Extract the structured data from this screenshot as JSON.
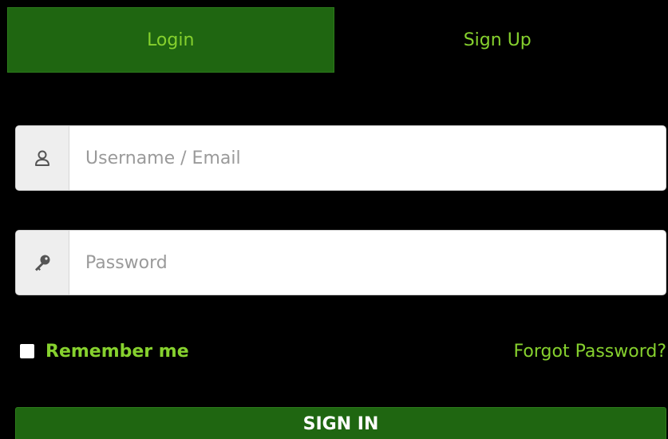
{
  "tabs": {
    "login_label": "Login",
    "signup_label": "Sign Up"
  },
  "form": {
    "username": {
      "placeholder": "Username / Email",
      "value": "",
      "icon": "user-icon"
    },
    "password": {
      "placeholder": "Password",
      "value": "",
      "icon": "key-icon"
    },
    "remember_label": "Remember me",
    "remember_checked": false,
    "forgot_label": "Forgot Password?",
    "submit_label": "SIGN IN"
  },
  "colors": {
    "background": "#000000",
    "accent_green": "#86d12e",
    "tab_active": "#1f6611",
    "button": "#1f6611"
  }
}
